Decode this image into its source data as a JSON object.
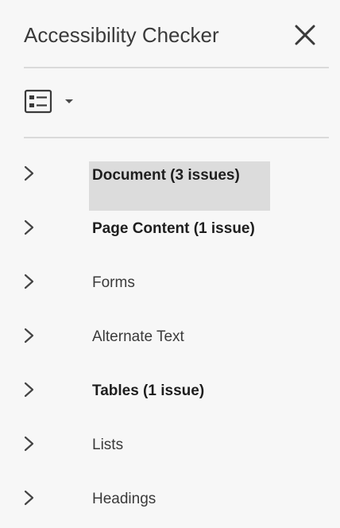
{
  "panel": {
    "title": "Accessibility Checker",
    "close_icon": "close-icon",
    "options_icon": "list-options-icon",
    "options_caret_icon": "caret-down-icon"
  },
  "items": [
    {
      "label": "Document (3 issues)",
      "bold": true,
      "selected": true
    },
    {
      "label": "Page Content (1 issue)",
      "bold": true,
      "selected": false
    },
    {
      "label": "Forms",
      "bold": false,
      "selected": false
    },
    {
      "label": "Alternate Text",
      "bold": false,
      "selected": false
    },
    {
      "label": "Tables (1 issue)",
      "bold": true,
      "selected": false
    },
    {
      "label": "Lists",
      "bold": false,
      "selected": false
    },
    {
      "label": "Headings",
      "bold": false,
      "selected": false
    }
  ],
  "colors": {
    "background": "#f7f7f7",
    "selection": "#dcdcdc",
    "divider": "#dadada",
    "text": "#3a3a3a"
  }
}
